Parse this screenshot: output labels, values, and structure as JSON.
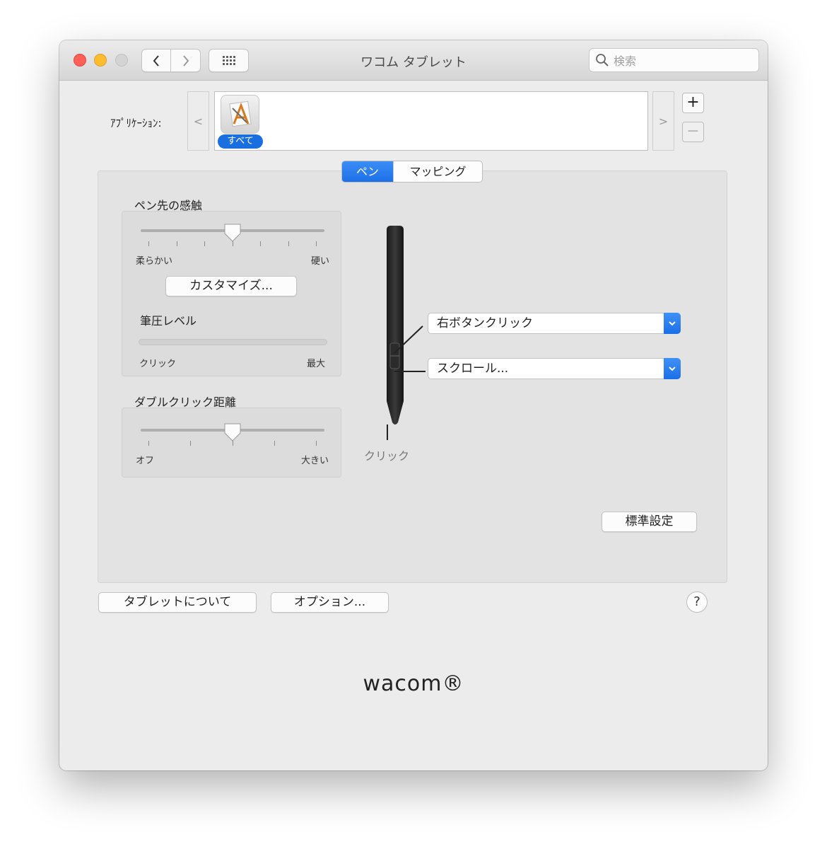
{
  "window": {
    "title": "ワコム タブレット"
  },
  "search": {
    "placeholder": "検索"
  },
  "applications": {
    "label": "ｱﾌﾟﾘｹｰｼｮﾝ:",
    "left_arrow": "<",
    "right_arrow": ">",
    "selected": "すべて",
    "add": "+",
    "remove": "−"
  },
  "tabs": [
    {
      "label": "ペン",
      "active": true
    },
    {
      "label": "マッピング",
      "active": false
    }
  ],
  "tip_feel": {
    "title": "ペン先の感触",
    "min_label": "柔らかい",
    "max_label": "硬い",
    "value_fraction": 0.5,
    "customize_button": "カスタマイズ...",
    "pressure_title": "筆圧レベル",
    "pressure_min": "クリック",
    "pressure_max": "最大"
  },
  "double_click": {
    "title": "ダブルクリック距離",
    "min_label": "オフ",
    "max_label": "大きい",
    "value_fraction": 0.5
  },
  "pen_buttons": {
    "upper": "右ボタンクリック",
    "lower": "スクロール...",
    "tip": "クリック"
  },
  "buttons": {
    "default": "標準設定",
    "about": "タブレットについて",
    "options": "オプション...",
    "help": "?"
  },
  "logo": "wacom®",
  "colors": {
    "accent": "#1d6fe8",
    "close": "#fe5f57",
    "minimize": "#febc2e"
  }
}
